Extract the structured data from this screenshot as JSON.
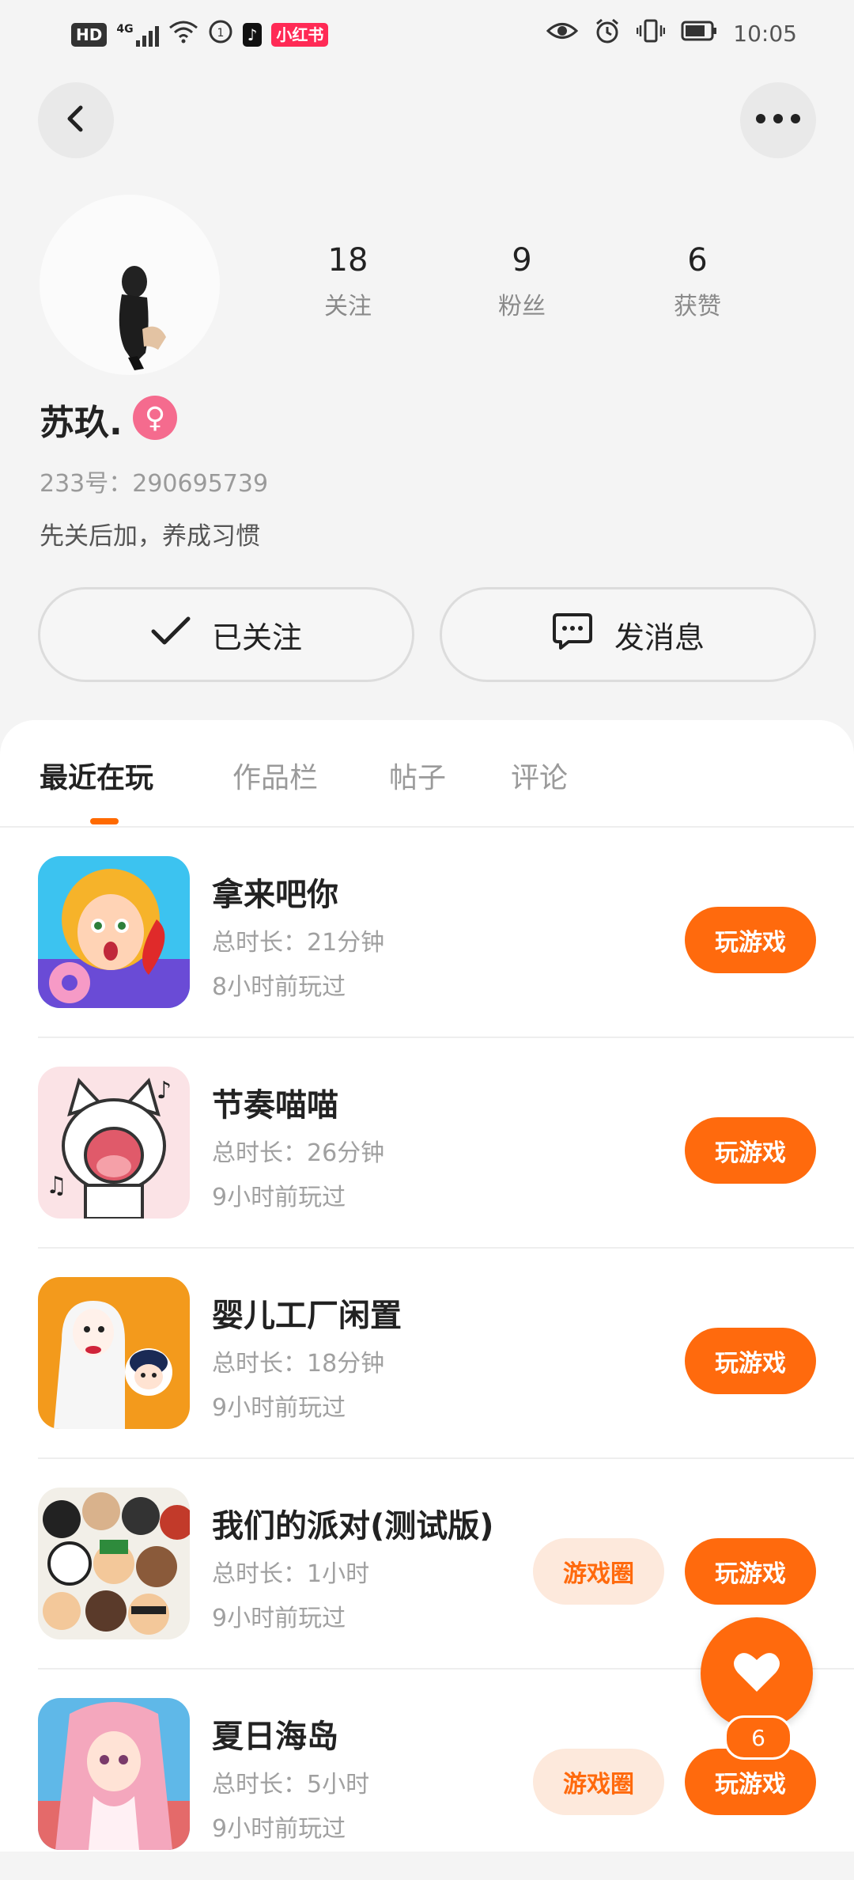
{
  "status_bar": {
    "hd": "HD",
    "net": "4G",
    "app1": "小红书",
    "time": "10:05"
  },
  "header": {
    "back_icon": "chevron-left-icon",
    "more_icon": "more-horizontal-icon"
  },
  "profile": {
    "stats": [
      {
        "value": "18",
        "label": "关注"
      },
      {
        "value": "9",
        "label": "粉丝"
      },
      {
        "value": "6",
        "label": "获赞"
      }
    ],
    "name": "苏玖.",
    "gender_symbol": "♀",
    "uid": "233号：290695739",
    "bio": "先关后加，养成习惯",
    "follow_button": "已关注",
    "message_button": "发消息"
  },
  "tabs": [
    "最近在玩",
    "作品栏",
    "帖子",
    "评论"
  ],
  "games": [
    {
      "title": "拿来吧你",
      "duration": "总时长：21分钟",
      "last": "8小时前玩过",
      "circle": "",
      "play": "玩游戏"
    },
    {
      "title": "节奏喵喵",
      "duration": "总时长：26分钟",
      "last": "9小时前玩过",
      "circle": "",
      "play": "玩游戏"
    },
    {
      "title": "婴儿工厂闲置",
      "duration": "总时长：18分钟",
      "last": "9小时前玩过",
      "circle": "",
      "play": "玩游戏"
    },
    {
      "title": "我们的派对(测试版)",
      "duration": "总时长：1小时",
      "last": "9小时前玩过",
      "circle": "游戏圈",
      "play": "玩游戏"
    },
    {
      "title": "夏日海岛",
      "duration": "总时长：5小时",
      "last": "9小时前玩过",
      "circle": "游戏圈",
      "play": "玩游戏"
    }
  ],
  "fab": {
    "count": "6"
  },
  "colors": {
    "accent": "#ff6a0d",
    "circle_bg": "#fde9dc",
    "gender_pink": "#f56b8e"
  }
}
